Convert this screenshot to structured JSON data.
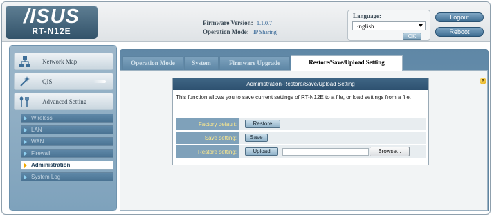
{
  "brand": {
    "logo": "/ISUS",
    "model": "RT-N12E"
  },
  "header": {
    "firmware_label": "Firmware Version:",
    "firmware_value": "1.1.0.7",
    "opmode_label": "Operation Mode:",
    "opmode_value": "IP Sharing",
    "language_label": "Language:",
    "language_value": "English",
    "ok_label": "OK",
    "logout_label": "Logout",
    "reboot_label": "Reboot"
  },
  "sidebar": {
    "main_items": [
      {
        "label": "Network Map",
        "icon": "network-map-icon"
      },
      {
        "label": "QIS",
        "icon": "qis-wand-icon"
      },
      {
        "label": "Advanced Setting",
        "icon": "advanced-setting-icon"
      }
    ],
    "sub_items": [
      {
        "label": "Wireless"
      },
      {
        "label": "LAN"
      },
      {
        "label": "WAN"
      },
      {
        "label": "Firewall"
      },
      {
        "label": "Administration",
        "active": true
      },
      {
        "label": "System Log"
      }
    ]
  },
  "tabs": [
    {
      "label": "Operation Mode"
    },
    {
      "label": "System"
    },
    {
      "label": "Firmware Upgrade"
    },
    {
      "label": "Restore/Save/Upload Setting",
      "active": true
    }
  ],
  "panel": {
    "title": "Administration-Restore/Save/Upload Setting",
    "description": "This function allows you to save current settings of RT-N12E to a file, or load settings from a file.",
    "rows": [
      {
        "label": "Factory default:",
        "button": "Restore"
      },
      {
        "label": "Save setting:",
        "button": "Save"
      },
      {
        "label": "Restore setting:",
        "button": "Upload",
        "browse": "Browse..."
      }
    ],
    "help": "?"
  },
  "colors": {
    "accent": "#3f6584",
    "sidebar": "#8fadc3",
    "label_text": "#ffea8c",
    "active_arrow": "#f0a800"
  }
}
